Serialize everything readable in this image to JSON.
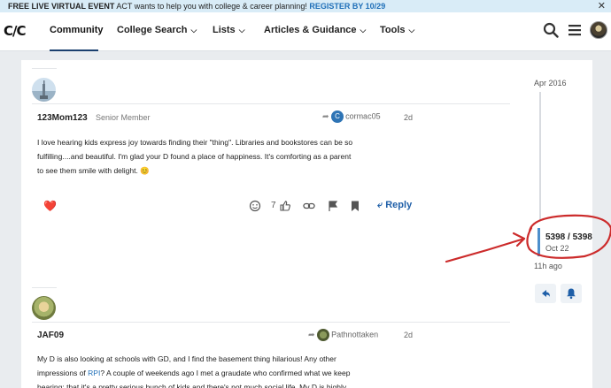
{
  "banner": {
    "lead": "FREE LIVE VIRTUAL EVENT",
    "text": " ACT wants to help you with college & career planning! ",
    "cta": "REGISTER BY 10/29",
    "close": "✕"
  },
  "nav": {
    "logo": "C/C",
    "items": [
      {
        "label": "Community"
      },
      {
        "label": "College Search"
      },
      {
        "label": "Lists"
      },
      {
        "label": "Articles & Guidance"
      },
      {
        "label": "Tools"
      }
    ]
  },
  "posts": [
    {
      "username": "123Mom123",
      "role": "Senior Member",
      "reply_to_initial": "C",
      "reply_to": "cormac05",
      "date": "2d",
      "lines": [
        "I love hearing kids express joy towards finding their \"thing\". Libraries and bookstores can be so",
        "fulfilling....and beautiful. I'm glad your D found a place of happiness. It's comforting as a parent",
        "to see them smile with delight. 😊"
      ],
      "reaction": "❤️",
      "like_count": "7",
      "reply_label": "Reply"
    },
    {
      "username": "JAF09",
      "reply_to": "Pathnottaken",
      "date": "2d",
      "line1": "My D is also looking at schools with GD, and I find the basement thing hilarious! Any other",
      "line2_a": "impressions of ",
      "line2_link": "RPI",
      "line2_b": "? A couple of weekends ago I met a graudate who confirmed what we keep",
      "line3": "hearing: that it's a pretty serious bunch of kids and there's not much social life. My D is highly"
    }
  ],
  "timeline": {
    "start_date": "Apr 2016",
    "position": "5398 / 5398",
    "position_date": "Oct 22",
    "last_activity": "11h ago"
  },
  "colors": {
    "accent": "#1f5fa8",
    "banner_bg": "#d9ecf7",
    "annotation": "#cc2b2b"
  }
}
